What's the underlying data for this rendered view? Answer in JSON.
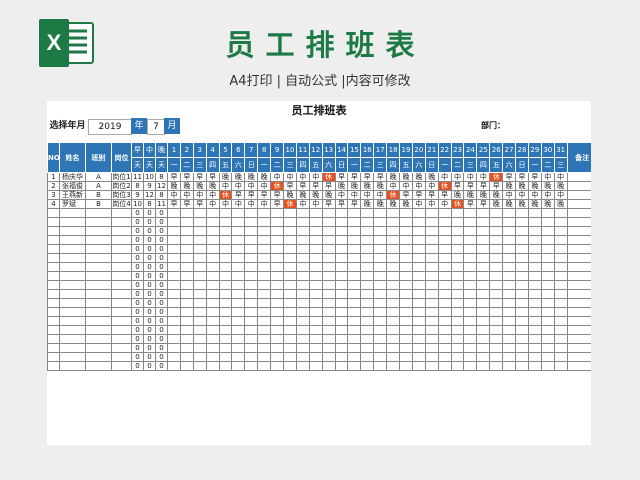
{
  "page": {
    "title": "员工排班表",
    "subtitle": "A4打印 | 自动公式 |内容可修改",
    "logo": "excel-icon",
    "accent": "#1e7a45",
    "header_blue": "#2e75b6",
    "rest_color": "#e8501e"
  },
  "sheet": {
    "title": "员工排班表",
    "select_label": "选择年月",
    "year": "2019",
    "year_unit": "年",
    "month": "7",
    "month_unit": "月",
    "dept_label": "部门："
  },
  "table": {
    "col_no": "NO",
    "col_name": "姓名",
    "col_class": "班别",
    "col_post": "岗位",
    "shift_labels": [
      "早",
      "中",
      "晚"
    ],
    "shift_sub": [
      "天",
      "天",
      "天"
    ],
    "days": [
      "1",
      "2",
      "3",
      "4",
      "5",
      "6",
      "7",
      "8",
      "9",
      "10",
      "11",
      "12",
      "13",
      "14",
      "15",
      "16",
      "17",
      "18",
      "19",
      "20",
      "21",
      "22",
      "23",
      "24",
      "25",
      "26",
      "27",
      "28",
      "29",
      "30",
      "31"
    ],
    "weekdays": [
      "一",
      "二",
      "三",
      "四",
      "五",
      "六",
      "日",
      "一",
      "二",
      "三",
      "四",
      "五",
      "六",
      "日",
      "一",
      "二",
      "三",
      "四",
      "五",
      "六",
      "日",
      "一",
      "二",
      "三",
      "四",
      "五",
      "六",
      "日",
      "一",
      "二",
      "三"
    ],
    "col_note": "备注",
    "rows": [
      {
        "no": "1",
        "name": "杨庆华",
        "class": "A",
        "post": "岗位1",
        "e": "11",
        "m": "10",
        "n": "8",
        "days": [
          "早",
          "早",
          "早",
          "早",
          "晚",
          "晚",
          "晚",
          "晚",
          "中",
          "中",
          "中",
          "中",
          "休",
          "早",
          "早",
          "早",
          "早",
          "晚",
          "晚",
          "晚",
          "晚",
          "中",
          "中",
          "中",
          "中",
          "休",
          "早",
          "早",
          "早",
          "中",
          "中"
        ]
      },
      {
        "no": "2",
        "name": "张福俊",
        "class": "A",
        "post": "岗位2",
        "e": "8",
        "m": "9",
        "n": "12",
        "days": [
          "晚",
          "晚",
          "晚",
          "晚",
          "中",
          "中",
          "中",
          "中",
          "休",
          "早",
          "早",
          "早",
          "早",
          "晚",
          "晚",
          "晚",
          "晚",
          "中",
          "中",
          "中",
          "中",
          "休",
          "早",
          "早",
          "早",
          "早",
          "晚",
          "晚",
          "晚",
          "晚",
          "晚"
        ]
      },
      {
        "no": "3",
        "name": "王燕新",
        "class": "B",
        "post": "岗位3",
        "e": "9",
        "m": "12",
        "n": "8",
        "days": [
          "中",
          "中",
          "中",
          "中",
          "休",
          "早",
          "早",
          "早",
          "早",
          "晚",
          "晚",
          "晚",
          "晚",
          "中",
          "中",
          "中",
          "中",
          "休",
          "早",
          "早",
          "早",
          "早",
          "晚",
          "晚",
          "晚",
          "晚",
          "中",
          "中",
          "中",
          "中",
          "中"
        ]
      },
      {
        "no": "4",
        "name": "罗斌",
        "class": "B",
        "post": "岗位4",
        "e": "10",
        "m": "8",
        "n": "11",
        "days": [
          "早",
          "早",
          "早",
          "中",
          "中",
          "中",
          "中",
          "中",
          "早",
          "休",
          "中",
          "中",
          "早",
          "早",
          "早",
          "晚",
          "晚",
          "晚",
          "晚",
          "中",
          "中",
          "中",
          "休",
          "早",
          "早",
          "晚",
          "晚",
          "晚",
          "晚",
          "晚",
          "晚"
        ]
      }
    ],
    "empty_row_value": "0",
    "empty_row_count": 18
  }
}
